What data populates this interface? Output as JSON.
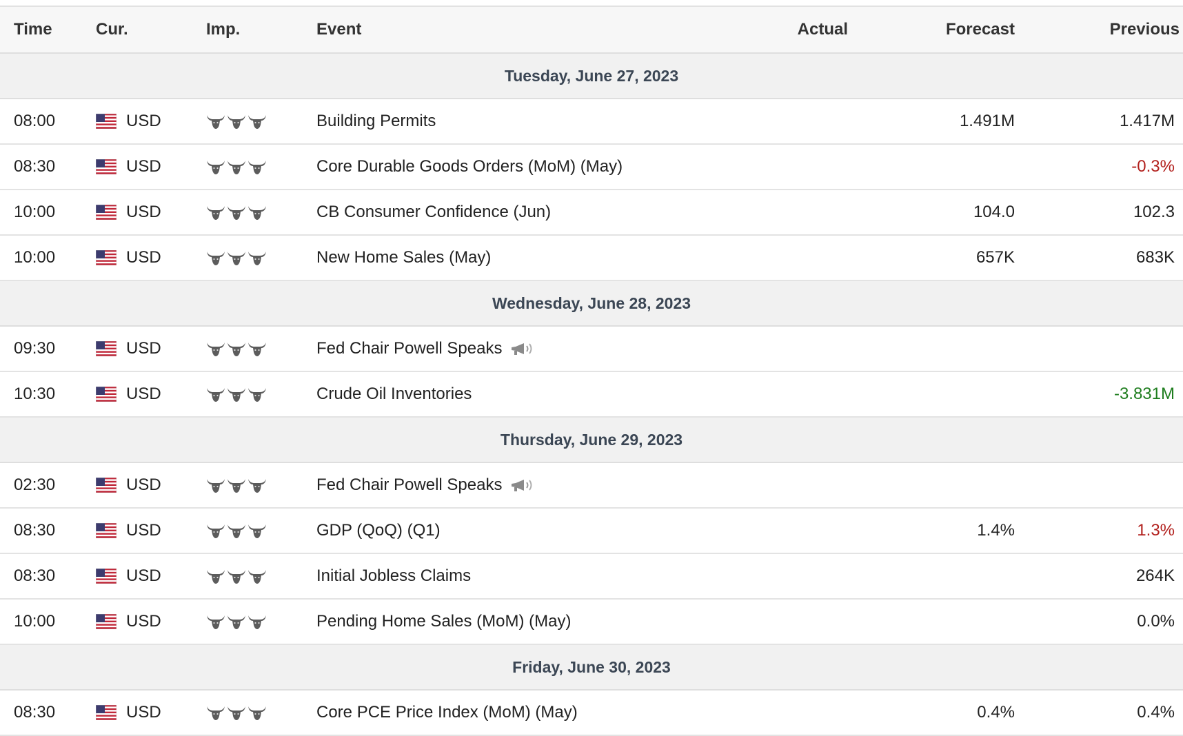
{
  "header": {
    "time": "Time",
    "currency": "Cur.",
    "importance": "Imp.",
    "event": "Event",
    "actual": "Actual",
    "forecast": "Forecast",
    "previous": "Previous"
  },
  "colors": {
    "negative": "#b2201d",
    "positive": "#1e7d1e",
    "day_bg": "#f1f1f1"
  },
  "icons": {
    "flag": "us-flag-icon",
    "importance": "bull-icon",
    "speech": "speaker-icon"
  },
  "days": [
    {
      "label": "Tuesday, June 27, 2023",
      "events": [
        {
          "time": "08:00",
          "currency": "USD",
          "importance": 3,
          "event": "Building Permits",
          "actual": "",
          "forecast": "1.491M",
          "previous": "1.417M",
          "previous_tone": "neutral",
          "speech": false
        },
        {
          "time": "08:30",
          "currency": "USD",
          "importance": 3,
          "event": "Core Durable Goods Orders (MoM) (May)",
          "actual": "",
          "forecast": "",
          "previous": "-0.3%",
          "previous_tone": "negative",
          "speech": false
        },
        {
          "time": "10:00",
          "currency": "USD",
          "importance": 3,
          "event": "CB Consumer Confidence (Jun)",
          "actual": "",
          "forecast": "104.0",
          "previous": "102.3",
          "previous_tone": "neutral",
          "speech": false
        },
        {
          "time": "10:00",
          "currency": "USD",
          "importance": 3,
          "event": "New Home Sales (May)",
          "actual": "",
          "forecast": "657K",
          "previous": "683K",
          "previous_tone": "neutral",
          "speech": false
        }
      ]
    },
    {
      "label": "Wednesday, June 28, 2023",
      "events": [
        {
          "time": "09:30",
          "currency": "USD",
          "importance": 3,
          "event": "Fed Chair Powell Speaks",
          "actual": "",
          "forecast": "",
          "previous": "",
          "previous_tone": "neutral",
          "speech": true
        },
        {
          "time": "10:30",
          "currency": "USD",
          "importance": 3,
          "event": "Crude Oil Inventories",
          "actual": "",
          "forecast": "",
          "previous": "-3.831M",
          "previous_tone": "positive",
          "speech": false
        }
      ]
    },
    {
      "label": "Thursday, June 29, 2023",
      "events": [
        {
          "time": "02:30",
          "currency": "USD",
          "importance": 3,
          "event": "Fed Chair Powell Speaks",
          "actual": "",
          "forecast": "",
          "previous": "",
          "previous_tone": "neutral",
          "speech": true
        },
        {
          "time": "08:30",
          "currency": "USD",
          "importance": 3,
          "event": "GDP (QoQ) (Q1)",
          "actual": "",
          "forecast": "1.4%",
          "previous": "1.3%",
          "previous_tone": "negative",
          "speech": false
        },
        {
          "time": "08:30",
          "currency": "USD",
          "importance": 3,
          "event": "Initial Jobless Claims",
          "actual": "",
          "forecast": "",
          "previous": "264K",
          "previous_tone": "neutral",
          "speech": false
        },
        {
          "time": "10:00",
          "currency": "USD",
          "importance": 3,
          "event": "Pending Home Sales (MoM) (May)",
          "actual": "",
          "forecast": "",
          "previous": "0.0%",
          "previous_tone": "neutral",
          "speech": false
        }
      ]
    },
    {
      "label": "Friday, June 30, 2023",
      "events": [
        {
          "time": "08:30",
          "currency": "USD",
          "importance": 3,
          "event": "Core PCE Price Index (MoM) (May)",
          "actual": "",
          "forecast": "0.4%",
          "previous": "0.4%",
          "previous_tone": "neutral",
          "speech": false
        }
      ]
    }
  ]
}
